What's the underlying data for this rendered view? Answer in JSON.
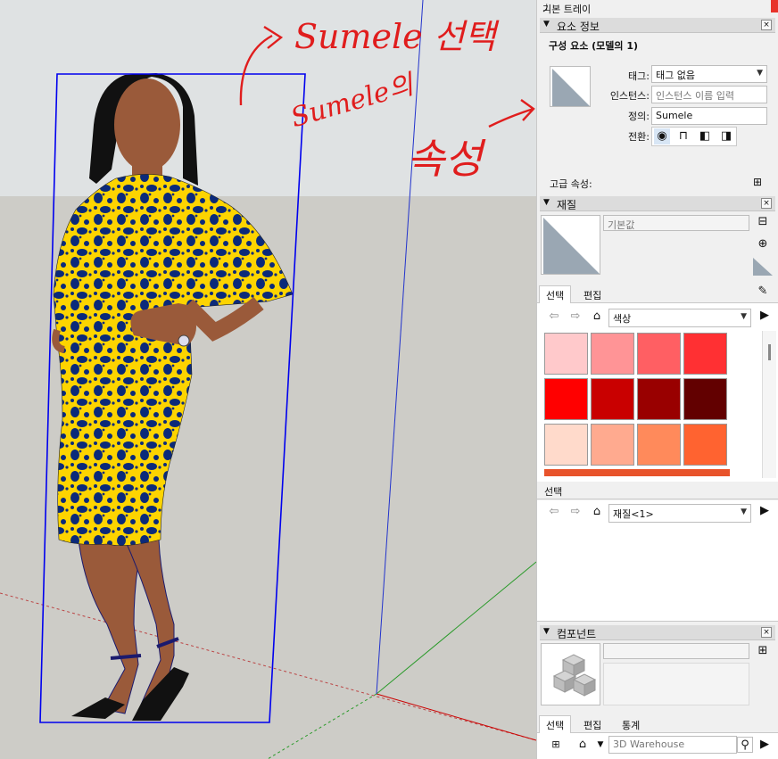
{
  "annotations": {
    "select_text": "Sumele 선택",
    "props_line1": "Sumele의",
    "props_line2": "속성"
  },
  "tray": {
    "title": "기본 트레이",
    "pin_icon": "pin-icon"
  },
  "entity_info": {
    "panel_title": "요소 정보",
    "component_heading": "구성 요소 (모델의 1)",
    "tag_label": "태그:",
    "tag_value": "태그 없음",
    "instance_label": "인스턴스:",
    "instance_placeholder": "인스턴스 이름 입력",
    "definition_label": "정의:",
    "definition_value": "Sumele",
    "toggle_label": "전환:",
    "toggles": [
      "eye-icon",
      "lock-icon",
      "receive-shadows-icon",
      "cast-shadows-icon"
    ],
    "advanced_label": "고급 속성:"
  },
  "materials": {
    "panel_title": "재질",
    "material_name": "기본값",
    "tabs": [
      "선택",
      "편집"
    ],
    "collection": "색상",
    "swatch_colors": [
      "#ffc9cb",
      "#ff9496",
      "#ff5f63",
      "#ff3033",
      "#ff0000",
      "#c90000",
      "#990000",
      "#620000",
      "#ffdacb",
      "#ffaa8f",
      "#ff8a5b",
      "#ff6330"
    ],
    "second_select_label": "선택",
    "second_collection": "재질<1>"
  },
  "components": {
    "panel_title": "컴포넌트",
    "tabs": [
      "선택",
      "편집",
      "통계"
    ],
    "search_placeholder": "3D Warehouse"
  },
  "colors": {
    "selection_blue": "#0000ee",
    "annotation_red": "#e01d1d",
    "dress_yellow": "#fdd400",
    "dot_navy": "#0b2a7a",
    "skin": "#9a5a3a"
  }
}
